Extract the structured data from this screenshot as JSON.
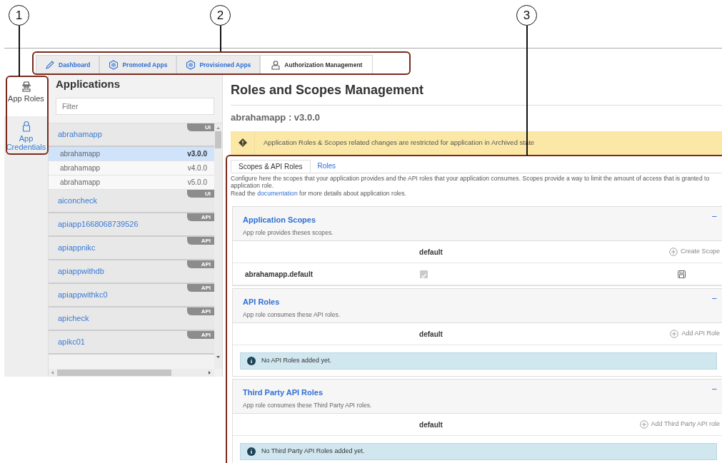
{
  "callouts": [
    {
      "label": "1"
    },
    {
      "label": "2"
    },
    {
      "label": "3"
    }
  ],
  "top_tabs": [
    {
      "label": "Dashboard",
      "kind": "pencil",
      "selected": false
    },
    {
      "label": "Promoted Apps",
      "kind": "hexagon",
      "selected": false
    },
    {
      "label": "Provisioned Apps",
      "kind": "hexagon",
      "selected": false
    },
    {
      "label": "Authorization Management",
      "kind": "person",
      "selected": true
    }
  ],
  "sidebar": {
    "items": [
      {
        "label": "App Roles",
        "kind": "roles",
        "selected": true
      },
      {
        "label": "App Credentials",
        "kind": "lock",
        "selected": false
      }
    ]
  },
  "applications": {
    "title": "Applications",
    "filter": {
      "placeholder": "Filter"
    },
    "groups": [
      {
        "name": "abrahamapp",
        "tag": "UI",
        "versions": [
          {
            "name": "abrahamapp",
            "version": "v3.0.0",
            "selected": true
          },
          {
            "name": "abrahamapp",
            "version": "v4.0.0",
            "selected": false
          },
          {
            "name": "abrahamapp",
            "version": "v5.0.0",
            "selected": false
          }
        ]
      },
      {
        "name": "aiconcheck",
        "tag": "UI"
      },
      {
        "name": "apiapp1668068739526",
        "tag": "API"
      },
      {
        "name": "apiappnikc",
        "tag": "API"
      },
      {
        "name": "apiappwithdb",
        "tag": "API"
      },
      {
        "name": "apiappwithkc0",
        "tag": "API"
      },
      {
        "name": "apicheck",
        "tag": "API"
      },
      {
        "name": "apikc01",
        "tag": "API"
      }
    ]
  },
  "main": {
    "title": "Roles and Scopes Management",
    "subtitle": "abrahamapp : v3.0.0",
    "alert": {
      "text": "Application Roles & Scopes related changes are restricted for application in Archived state"
    },
    "tabs": [
      {
        "label": "Scopes & API Roles",
        "selected": true
      },
      {
        "label": "Roles",
        "selected": false
      }
    ],
    "description_lines": [
      "Configure here the scopes that your application provides and the API roles that your application consumes. Scopes provide a way to limit the amount of access that is granted to",
      "application role."
    ],
    "read_more": {
      "prefix": "Read the",
      "link": "documentation",
      "suffix": "for more details about application roles."
    },
    "sections": [
      {
        "title": "Application Scopes",
        "description": "App role provides theses scopes.",
        "collapse": "−",
        "column_header": "default",
        "action": "Create Scope",
        "rows": [
          {
            "name": "abrahamapp.default",
            "checked": true
          }
        ]
      },
      {
        "title": "API Roles",
        "description": "App role consumes these API roles.",
        "collapse": "−",
        "column_header": "default",
        "action": "Add API Role",
        "empty_message": "No API Roles added yet."
      },
      {
        "title": "Third Party API Roles",
        "description": "App role consumes these Third Party API roles.",
        "collapse": "−",
        "column_header": "default",
        "action": "Add Third Party API role",
        "empty_message": "No Third Party API Roles added yet."
      }
    ]
  }
}
